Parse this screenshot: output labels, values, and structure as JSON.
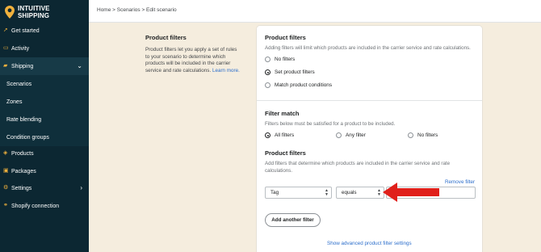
{
  "brand": {
    "line1": "INTUITIVE",
    "line2": "SHIPPING",
    "accent": "#f0b13d",
    "sidebar_bg": "#0c2732"
  },
  "sidebar": {
    "items": [
      {
        "label": "Get started",
        "icon": "rocket-icon"
      },
      {
        "label": "Activity",
        "icon": "activity-icon"
      },
      {
        "label": "Shipping",
        "icon": "truck-icon",
        "expanded": true
      },
      {
        "label": "Scenarios"
      },
      {
        "label": "Zones"
      },
      {
        "label": "Rate blending"
      },
      {
        "label": "Condition groups"
      },
      {
        "label": "Products",
        "icon": "tag-icon"
      },
      {
        "label": "Packages",
        "icon": "box-icon"
      },
      {
        "label": "Settings",
        "icon": "gear-icon"
      },
      {
        "label": "Shopify connection",
        "icon": "link-icon"
      }
    ]
  },
  "breadcrumb": "Home > Scenarios > Edit scenario",
  "left_panel": {
    "title": "Product filters",
    "description": "Product filters let you apply a set of rules to your scenario to determine which products will be included in the carrier service and rate calculations.",
    "learn_more": "Learn more."
  },
  "product_filters": {
    "title": "Product filters",
    "help": "Adding filters will limit which products are included in the carrier service and rate calculations.",
    "options": [
      "No filters",
      "Set product filters",
      "Match product conditions"
    ],
    "selected": "Set product filters"
  },
  "filter_match": {
    "title": "Filter match",
    "help": "Filters below must be satisfied for a product to be included.",
    "options": [
      "All filters",
      "Any filter",
      "No filters"
    ],
    "selected": "All filters"
  },
  "filters_section": {
    "title": "Product filters",
    "help": "Add filters that determine which products are included in the carrier service and rate calculations.",
    "remove_label": "Remove filter",
    "field_value": "Tag",
    "operator_value": "equals",
    "value": "",
    "add_button": "Add another filter",
    "advanced_link": "Show advanced product filter settings"
  },
  "annotation_color": "#e0201b"
}
